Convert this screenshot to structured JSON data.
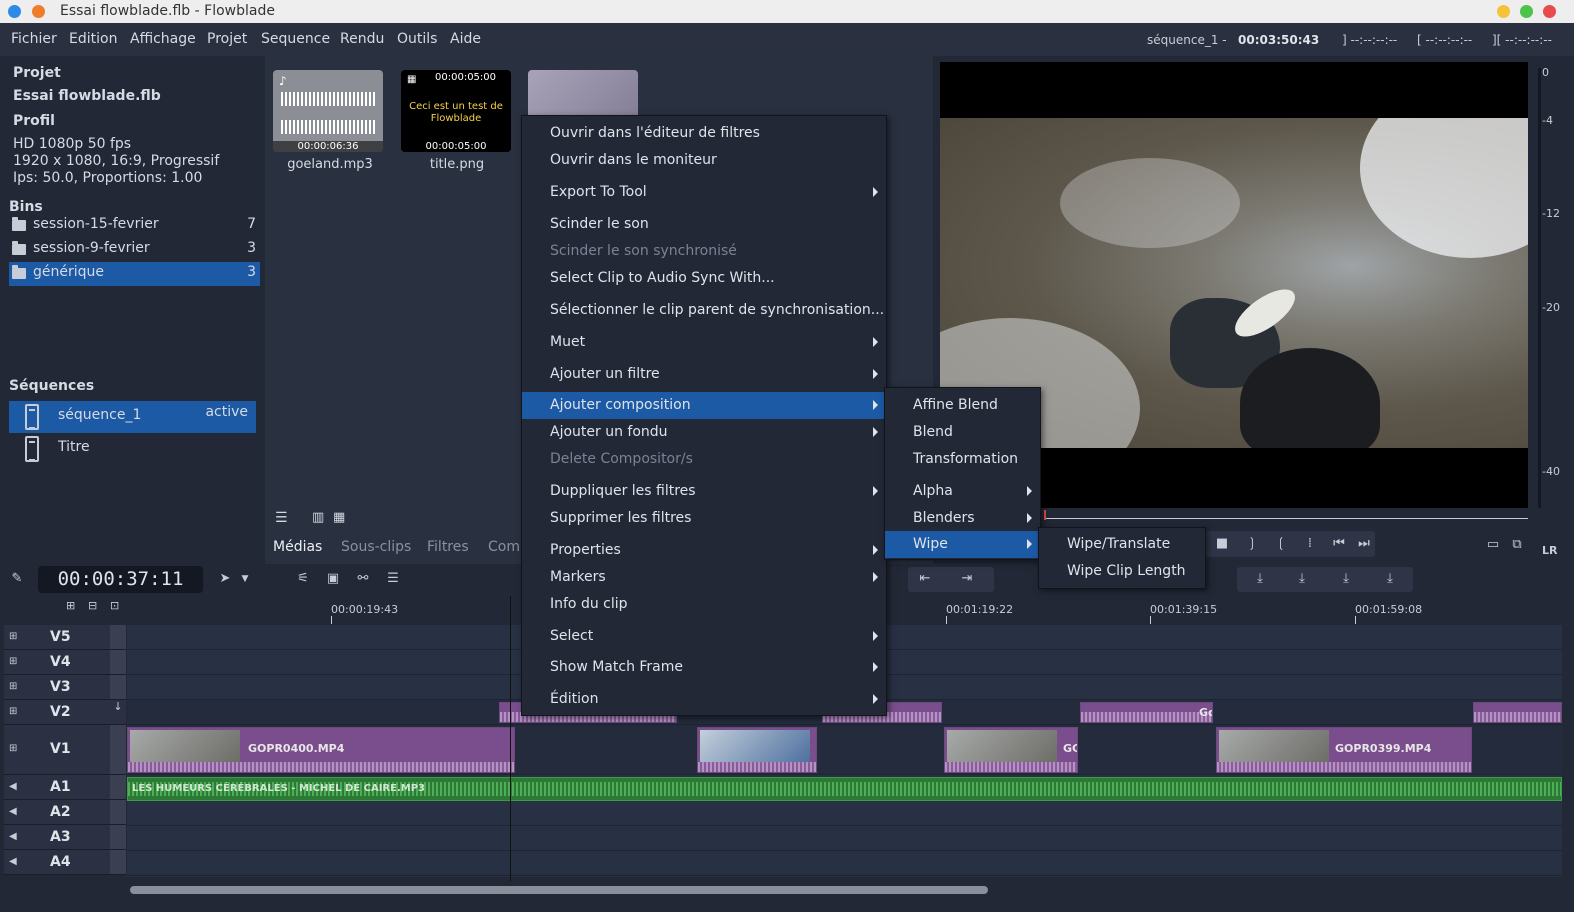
{
  "window": {
    "title": "Essai flowblade.flb - Flowblade"
  },
  "menubar": {
    "items": [
      "Fichier",
      "Edition",
      "Affichage",
      "Projet",
      "Sequence",
      "Rendu",
      "Outils",
      "Aide"
    ]
  },
  "sequence_info": {
    "name": "séquence_1 - ",
    "time": "00:03:50:43",
    "mark_in": "] --:--:--:--",
    "mark_out": "[ --:--:--:--",
    "length": "][ --:--:--:--"
  },
  "project": {
    "project_label": "Projet",
    "name": "Essai flowblade.flb",
    "profile_label": "Profil",
    "profile_name": "HD 1080p 50 fps",
    "profile_res": "1920 x 1080, 16:9, Progressif",
    "profile_fps": "Ips: 50.0, Proportions: 1.00"
  },
  "bins": {
    "label": "Bins",
    "items": [
      {
        "name": "session-15-fevrier",
        "count": "7"
      },
      {
        "name": "session-9-fevrier",
        "count": "3"
      },
      {
        "name": "générique",
        "count": "3"
      }
    ]
  },
  "sequences": {
    "label": "Séquences",
    "items": [
      {
        "name": "séquence_1",
        "status": "active"
      },
      {
        "name": "Titre",
        "status": ""
      }
    ]
  },
  "media": {
    "items": [
      {
        "name": "goeland.mp3",
        "duration": "00:00:06:36"
      },
      {
        "name": "title.png",
        "duration": "00:00:05:00",
        "top_time": "00:00:05:00",
        "overlay_line1": "Ceci est un test de",
        "overlay_line2": "Flowblade"
      }
    ],
    "tabs": [
      "Médias",
      "Sous-clips",
      "Filtres",
      "Comp"
    ]
  },
  "monitor": {
    "scale": [
      "0",
      "-4",
      "-12",
      "-20",
      "-40"
    ],
    "lr": "LR"
  },
  "timeline": {
    "timecode": "00:00:37:11",
    "ruler": [
      "00:00:19:43",
      "00:01:19:22",
      "00:01:39:15",
      "00:01:59:08"
    ],
    "tracks": [
      "V5",
      "V4",
      "V3",
      "V2",
      "V1",
      "A1",
      "A2",
      "A3",
      "A4"
    ],
    "clips": {
      "v1_a": "GOPR0400.MP4",
      "v1_b": "GC",
      "v1_c": "GOPR0399.MP4",
      "v2_a": "Gc",
      "a1": "LES HUMEURS CÉRÉBRALES - MICHEL DE CAIRE.MP3"
    }
  },
  "context_menu": {
    "items": [
      {
        "label": "Ouvrir dans l'éditeur de filtres",
        "submenu": false,
        "disabled": false
      },
      {
        "label": "Ouvrir dans le moniteur",
        "submenu": false,
        "disabled": false
      },
      {
        "label": "Export To Tool",
        "submenu": true,
        "disabled": false
      },
      {
        "label": "Scinder le son",
        "submenu": false,
        "disabled": false
      },
      {
        "label": "Scinder le son synchronisé",
        "submenu": false,
        "disabled": true
      },
      {
        "label": "Select Clip to Audio Sync With...",
        "submenu": false,
        "disabled": false
      },
      {
        "label": "Sélectionner le clip parent de synchronisation...",
        "submenu": false,
        "disabled": false
      },
      {
        "label": "Muet",
        "submenu": true,
        "disabled": false
      },
      {
        "label": "Ajouter un filtre",
        "submenu": true,
        "disabled": false
      },
      {
        "label": "Ajouter composition",
        "submenu": true,
        "disabled": false,
        "selected": true
      },
      {
        "label": "Ajouter un fondu",
        "submenu": true,
        "disabled": false
      },
      {
        "label": "Delete Compositor/s",
        "submenu": false,
        "disabled": true
      },
      {
        "label": "Duppliquer les filtres",
        "submenu": true,
        "disabled": false
      },
      {
        "label": "Supprimer les filtres",
        "submenu": false,
        "disabled": false
      },
      {
        "label": "Properties",
        "submenu": true,
        "disabled": false
      },
      {
        "label": "Markers",
        "submenu": true,
        "disabled": false
      },
      {
        "label": "Info du clip",
        "submenu": false,
        "disabled": false
      },
      {
        "label": "Select",
        "submenu": true,
        "disabled": false
      },
      {
        "label": "Show Match Frame",
        "submenu": true,
        "disabled": false
      },
      {
        "label": "Édition",
        "submenu": true,
        "disabled": false
      }
    ]
  },
  "composition_menu": {
    "items": [
      {
        "label": "Affine Blend",
        "submenu": false
      },
      {
        "label": "Blend",
        "submenu": false
      },
      {
        "label": "Transformation",
        "submenu": false
      },
      {
        "label": "Alpha",
        "submenu": true
      },
      {
        "label": "Blenders",
        "submenu": true
      },
      {
        "label": "Wipe",
        "submenu": true,
        "selected": true
      }
    ]
  },
  "wipe_menu": {
    "items": [
      "Wipe/Translate",
      "Wipe Clip Length"
    ]
  },
  "colors": {
    "accent": "#1c5aa6",
    "clip_video": "#7a4d8c",
    "clip_audio": "#2d7a36",
    "panel": "#232837"
  }
}
